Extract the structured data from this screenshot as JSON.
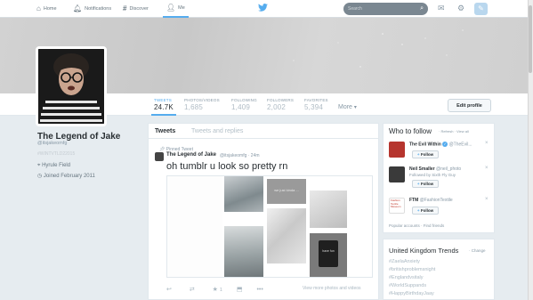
{
  "nav": {
    "home": "Home",
    "notifications": "Notifications",
    "discover": "Discover",
    "me": "Me"
  },
  "search": {
    "placeholder": "Search"
  },
  "profile": {
    "name": "The Legend of Jake",
    "handle": "@itsjakeomfg",
    "hashtag": "#WINTVTLD22015",
    "location": "Hyrule Field",
    "joined": "Joined February 2011"
  },
  "stats": [
    {
      "label": "TWEETS",
      "value": "24.7K"
    },
    {
      "label": "PHOTOS/VIDEOS",
      "value": "1,685"
    },
    {
      "label": "FOLLOWING",
      "value": "1,409"
    },
    {
      "label": "FOLLOWERS",
      "value": "2,002"
    },
    {
      "label": "FAVORITES",
      "value": "5,394"
    }
  ],
  "more_label": "More",
  "edit_profile": "Edit profile",
  "tabs": {
    "tweets": "Tweets",
    "replies": "Tweets and replies"
  },
  "tweet": {
    "pinned": "Pinned Tweet",
    "name": "The Legend of Jake",
    "meta": "@itsjakeomfg · 24m",
    "text": "oh tumblr u look so pretty rn",
    "view_more": "View more photos and videos",
    "fav_count": "1",
    "photo_text_1": "we just kinda ...",
    "photo_text_2": "have fun"
  },
  "who_to_follow": {
    "title": "Who to follow",
    "actions": "· Refresh · View all",
    "follow_label": "Follow",
    "links": "Popular accounts · Find friends",
    "suggestions": [
      {
        "name": "The Evil Within",
        "handle": "@TheEvil...",
        "by": ""
      },
      {
        "name": "Neil Smaller",
        "handle": "@neil_photo",
        "by": "Followed by Sixth Fly Guy"
      },
      {
        "name": "FTM",
        "handle": "@FashionTextile",
        "by": "",
        "logo_text": "Fashion Textile Museum"
      }
    ]
  },
  "trends": {
    "title": "United Kingdom Trends",
    "change": "· Change",
    "items": [
      "#ZaelaAnxiety",
      "#britishproblemsnight",
      "#Englandvsitaly",
      "#WorldSuppands",
      "#HappyBirthdayJaay"
    ]
  },
  "colors": {
    "accent": "#55acee",
    "text": "#292f33",
    "muted": "#8899a6",
    "background": "#e6ecf0"
  },
  "icons": {
    "home": "house-icon",
    "notifications": "bell-icon",
    "discover": "hash-icon",
    "me": "person-icon",
    "bird": "twitter-bird-icon"
  }
}
